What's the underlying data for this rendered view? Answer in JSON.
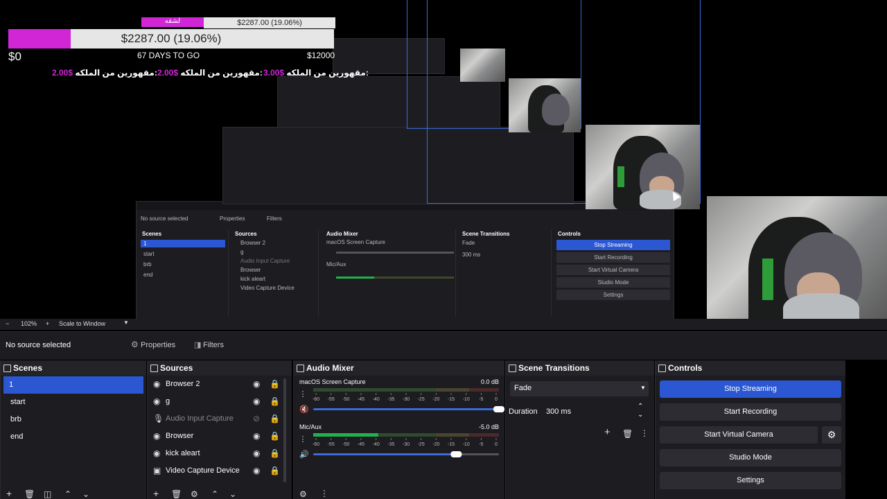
{
  "overlay": {
    "donation_amount": "$2287.00 (19.06%)",
    "goal_min": "$0",
    "days_left": "67 DAYS TO GO",
    "goal_max": "$12000",
    "progress_fraction": 0.1906,
    "brand_color": "#d026d6",
    "donors": [
      {
        "name": "مقهورين من الملكه:",
        "amount": "2.00$"
      },
      {
        "name": "مقهورين من الملكه:",
        "amount": "2.00$"
      },
      {
        "name": "مقهورين من الملكه:",
        "amount": "3.00$"
      }
    ],
    "nested_title": "لشقه"
  },
  "zoom": {
    "minus": "−",
    "value": "102%",
    "plus": "+",
    "scale_mode": "Scale to Window"
  },
  "toolbar": {
    "no_source": "No source selected",
    "properties": "Properties",
    "filters": "Filters"
  },
  "scenes": {
    "title": "Scenes",
    "items": [
      "1",
      "start",
      "brb",
      "end"
    ],
    "selected_index": 0
  },
  "sources": {
    "title": "Sources",
    "items": [
      {
        "name": "Browser 2",
        "icon": "globe-icon",
        "enabled": true
      },
      {
        "name": "g",
        "icon": "globe-icon",
        "enabled": true
      },
      {
        "name": "Audio Input Capture",
        "icon": "mic-icon",
        "enabled": false
      },
      {
        "name": "Browser",
        "icon": "globe-icon",
        "enabled": true
      },
      {
        "name": "kick aleart",
        "icon": "globe-icon",
        "enabled": true
      },
      {
        "name": "Video Capture Device",
        "icon": "camera-icon",
        "enabled": true
      }
    ]
  },
  "audio_mixer": {
    "title": "Audio Mixer",
    "channels": [
      {
        "name": "macOS Screen Capture",
        "db": "0.0 dB",
        "volume": 1.0,
        "level": 0.0,
        "muted": true
      },
      {
        "name": "Mic/Aux",
        "db": "-5.0 dB",
        "volume": 0.77,
        "level": 0.35,
        "muted": false
      }
    ],
    "scale": [
      "-60",
      "-55",
      "-50",
      "-45",
      "-40",
      "-35",
      "-30",
      "-25",
      "-20",
      "-15",
      "-10",
      "-5",
      "0"
    ]
  },
  "transitions": {
    "title": "Scene Transitions",
    "selected": "Fade",
    "duration_label": "Duration",
    "duration_value": "300 ms"
  },
  "controls": {
    "title": "Controls",
    "stop_streaming": "Stop Streaming",
    "start_recording": "Start Recording",
    "start_virtual_camera": "Start Virtual Camera",
    "studio_mode": "Studio Mode",
    "settings": "Settings"
  },
  "colors": {
    "accent": "#2b57d3",
    "panel": "#1d1d21",
    "meter_green": "#22b14c",
    "meter_yellow": "#c9b531",
    "meter_red": "#c0202a"
  }
}
